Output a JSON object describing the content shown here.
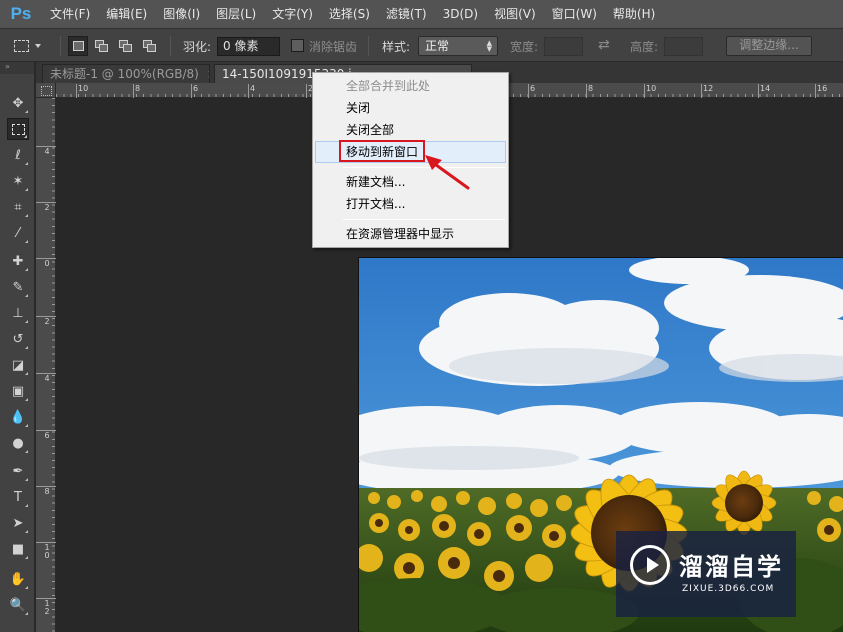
{
  "app": {
    "logo": "Ps",
    "menus": [
      "文件(F)",
      "编辑(E)",
      "图像(I)",
      "图层(L)",
      "文字(Y)",
      "选择(S)",
      "滤镜(T)",
      "3D(D)",
      "视图(V)",
      "窗口(W)",
      "帮助(H)"
    ]
  },
  "options": {
    "feather_label": "羽化:",
    "feather_value": "0 像素",
    "antialias_label": "消除锯齿",
    "style_label": "样式:",
    "style_value": "正常",
    "width_label": "宽度:",
    "height_label": "高度:",
    "refine_edge": "调整边缘..."
  },
  "tabs": [
    {
      "title": "未标题-1 @ 100%(RGB/8)",
      "close": "×"
    },
    {
      "title": "14-150I1091915330.j",
      "close": "×"
    }
  ],
  "ruler": {
    "h_labels": [
      "10",
      "8",
      "6",
      "4",
      "2",
      "0",
      "2",
      "4",
      "6",
      "8",
      "10",
      "12",
      "14",
      "16"
    ],
    "v_labels": [
      "4",
      "2",
      "0",
      "2",
      "4",
      "6",
      "8",
      "1\n0",
      "1\n2"
    ]
  },
  "context_menu": {
    "items": [
      {
        "label": "全部合并到此处",
        "disabled": true
      },
      {
        "label": "关闭"
      },
      {
        "label": "关闭全部"
      },
      {
        "label": "移动到新窗口",
        "highlighted": true
      },
      {
        "label": "新建文档..."
      },
      {
        "label": "打开文档..."
      },
      {
        "label": "在资源管理器中显示"
      }
    ]
  },
  "watermark": {
    "name": "溜溜自学",
    "url": "ZIXUE.3D66.COM"
  },
  "toolbox_icons": [
    "move-icon",
    "marquee-icon",
    "lasso-icon",
    "magic-wand-icon",
    "crop-icon",
    "eyedropper-icon",
    "healing-brush-icon",
    "brush-icon",
    "clone-stamp-icon",
    "history-brush-icon",
    "eraser-icon",
    "gradient-icon",
    "blur-icon",
    "dodge-icon",
    "pen-icon",
    "type-icon",
    "path-selection-icon",
    "rectangle-icon",
    "hand-icon",
    "zoom-icon"
  ],
  "colors": {
    "highlight_red": "#d8171f",
    "ps_blue": "#4fb0f0",
    "watermark_bg": "#182142"
  }
}
